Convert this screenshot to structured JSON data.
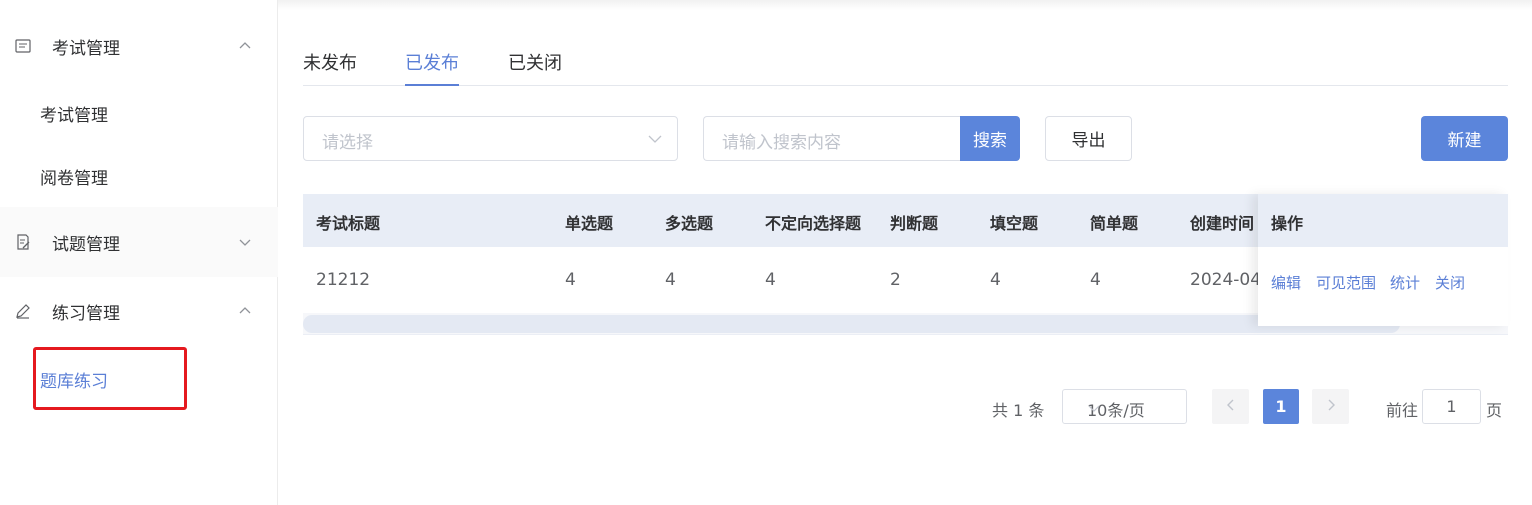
{
  "sidebar": {
    "groups": [
      {
        "label": "考试管理",
        "icon": "exam-doc-icon",
        "expanded": true,
        "items": [
          {
            "label": "考试管理"
          },
          {
            "label": "阅卷管理"
          }
        ]
      },
      {
        "label": "试题管理",
        "icon": "edit-doc-icon",
        "expanded": false,
        "items": []
      },
      {
        "label": "练习管理",
        "icon": "pencil-icon",
        "expanded": true,
        "items": [
          {
            "label": "题库练习",
            "active": true
          }
        ]
      }
    ]
  },
  "tabs": [
    {
      "label": "未发布",
      "active": false
    },
    {
      "label": "已发布",
      "active": true
    },
    {
      "label": "已关闭",
      "active": false
    }
  ],
  "toolbar": {
    "select_placeholder": "请选择",
    "search_placeholder": "请输入搜索内容",
    "search_label": "搜索",
    "export_label": "导出",
    "new_label": "新建"
  },
  "table": {
    "headers": [
      "考试标题",
      "单选题",
      "多选题",
      "不定向选择题",
      "判断题",
      "填空题",
      "简单题",
      "创建时间",
      "操作"
    ],
    "rows": [
      {
        "title": "21212",
        "single": "4",
        "multi": "4",
        "indefinite": "4",
        "judge": "2",
        "fill": "4",
        "simple": "4",
        "created": "2024-04-",
        "actions": [
          "编辑",
          "可见范围",
          "统计",
          "关闭"
        ]
      }
    ]
  },
  "pagination": {
    "total_text": "共 1 条",
    "page_size": "10条/页",
    "current_page": "1",
    "goto_label": "前往",
    "goto_value": "1",
    "page_suffix": "页"
  },
  "colors": {
    "accent": "#5b85db",
    "active_text": "#5b7fd6",
    "highlight_box": "#e5191f",
    "table_header_bg": "#e8edf6"
  }
}
